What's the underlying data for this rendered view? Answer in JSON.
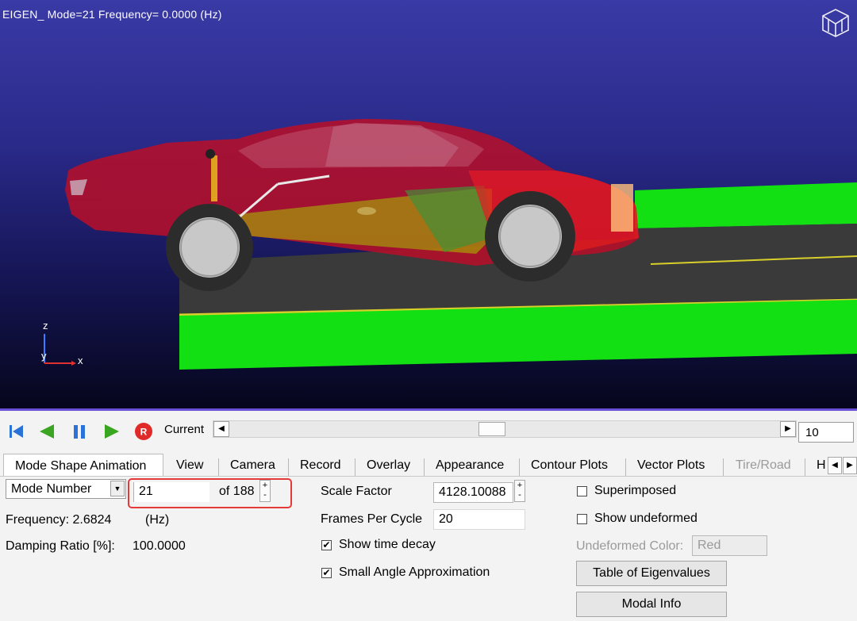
{
  "viewport": {
    "title": "EIGEN_  Mode=21  Frequency= 0.0000 (Hz)",
    "axes": {
      "z": "z",
      "y": "y",
      "x": "x"
    }
  },
  "toolbar": {
    "icons": [
      "skip-to-start-icon",
      "step-back-icon",
      "pause-icon",
      "play-icon",
      "record-icon"
    ],
    "record_glyph": "R",
    "current_label": "Current",
    "frame_value": "10"
  },
  "tabs": [
    {
      "label": "Mode Shape Animation",
      "active": true
    },
    {
      "label": "View"
    },
    {
      "label": "Camera"
    },
    {
      "label": "Record"
    },
    {
      "label": "Overlay"
    },
    {
      "label": "Appearance"
    },
    {
      "label": "Contour Plots"
    },
    {
      "label": "Vector Plots"
    },
    {
      "label": "Tire/Road",
      "disabled": true
    },
    {
      "label": "H"
    }
  ],
  "mode": {
    "select_value": "Mode Number",
    "number_value": "21",
    "of_label": "of 188",
    "frequency_label": "Frequency: 2.6824",
    "frequency_unit": "(Hz)",
    "damping_label": "Damping Ratio [%]:",
    "damping_value": "100.0000"
  },
  "scale": {
    "scale_label": "Scale Factor",
    "scale_value": "4128.10088",
    "fpc_label": "Frames Per Cycle",
    "fpc_value": "20",
    "time_decay_label": "Show time decay",
    "time_decay_checked": true,
    "small_angle_label": "Small Angle Approximation",
    "small_angle_checked": true
  },
  "options": {
    "superimposed_label": "Superimposed",
    "superimposed_checked": false,
    "show_undeformed_label": "Show undeformed",
    "show_undeformed_checked": false,
    "undeformed_color_label": "Undeformed Color:",
    "undeformed_color_value": "Red",
    "table_button": "Table of Eigenvalues",
    "modal_button": "Modal Info"
  },
  "colors": {
    "viewport_top": "#3a3aa6",
    "viewport_bottom": "#06061c",
    "road_green": "#13e013",
    "road_gray": "#3c3c3c",
    "car_red": "#c4102a",
    "highlight_red": "#e53a3a",
    "toolbar_blue": "#2a72d8",
    "toolbar_green": "#3aa520"
  }
}
